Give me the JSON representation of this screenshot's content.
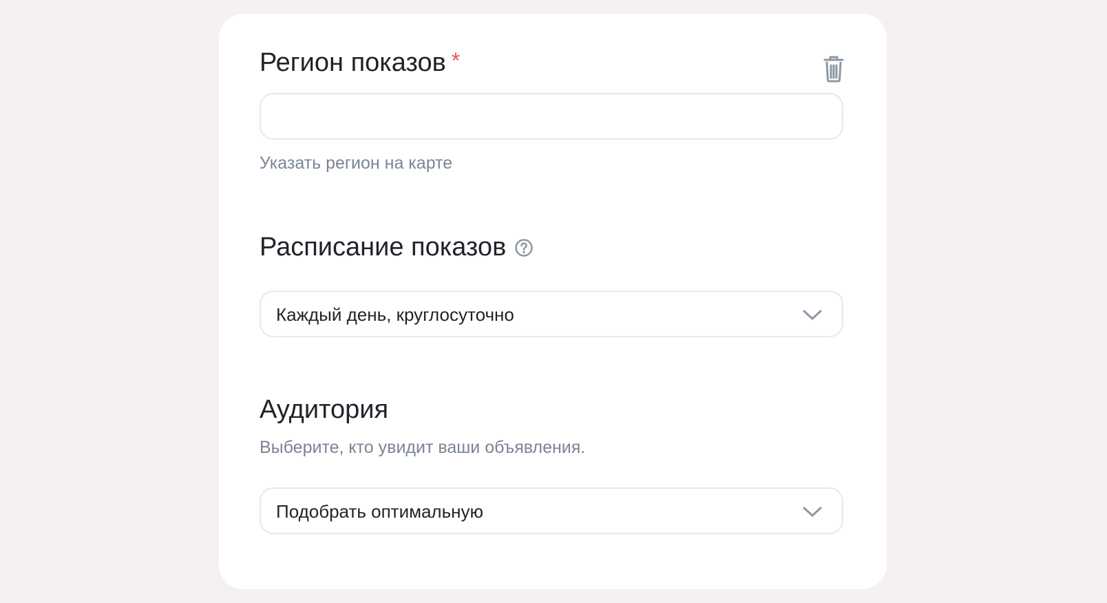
{
  "region": {
    "title": "Регион показов",
    "required_mark": "*",
    "input_value": "",
    "map_link": "Указать регион на карте",
    "delete_icon": "trash-icon"
  },
  "schedule": {
    "title": "Расписание показов",
    "help_icon": "question-circle-icon",
    "selected": "Каждый день, круглосуточно"
  },
  "audience": {
    "title": "Аудитория",
    "description": "Выберите, кто увидит ваши объявления.",
    "selected": "Подобрать оптимальную"
  },
  "colors": {
    "page_background": "#f6f1f1",
    "card_background": "#ffffff",
    "required_asterisk": "#e8544e",
    "muted_text": "#7a8494",
    "border": "#e6e8ec"
  }
}
